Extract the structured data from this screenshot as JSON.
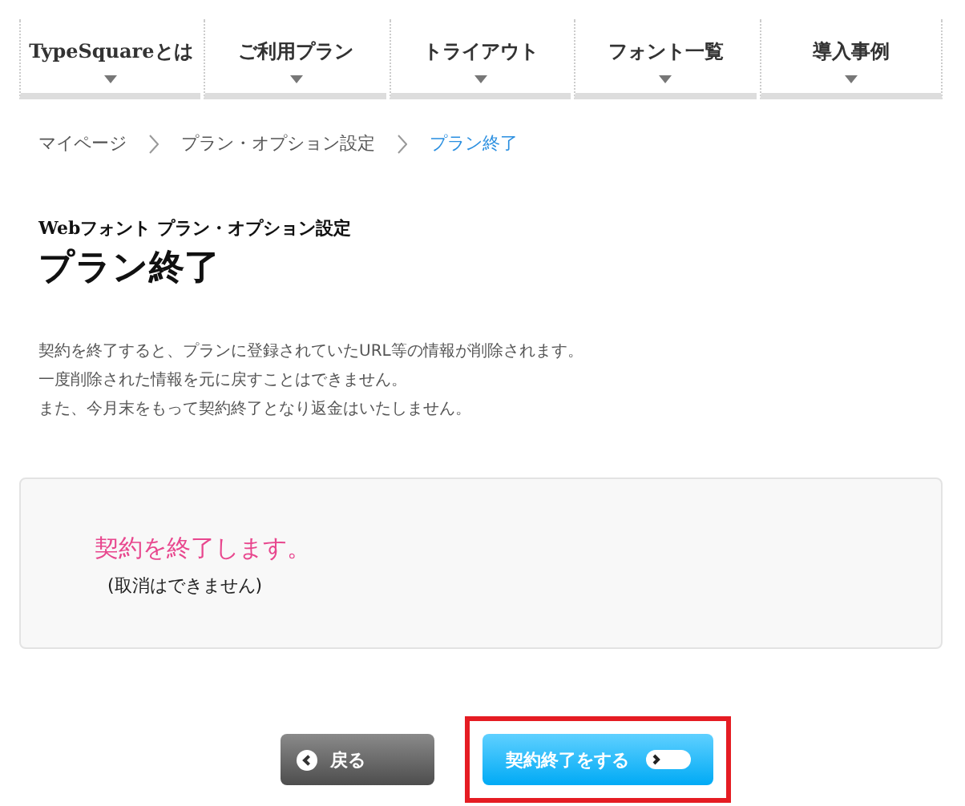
{
  "nav": [
    {
      "label": "TypeSquareとは"
    },
    {
      "label": "ご利用プラン"
    },
    {
      "label": "トライアウト"
    },
    {
      "label": "フォント一覧"
    },
    {
      "label": "導入事例"
    }
  ],
  "breadcrumb": [
    {
      "label": "マイページ",
      "selected": false
    },
    {
      "label": "プラン・オプション設定",
      "selected": false
    },
    {
      "label": "プラン終了",
      "selected": true
    }
  ],
  "subtitle": "Webフォント プラン・オプション設定",
  "title": "プラン終了",
  "notice": [
    "契約を終了すると、プランに登録されていたURL等の情報が削除されます。",
    "一度削除された情報を元に戻すことはできません。",
    "また、今月末をもって契約終了となり返金はいたしません。"
  ],
  "confirm_box": {
    "message": "契約を終了します。",
    "note": "(取消はできません)"
  },
  "buttons": [
    {
      "kind": "back",
      "label": "戻る",
      "highlighted": false
    },
    {
      "kind": "confirm",
      "label": "契約終了をする",
      "highlighted": true
    }
  ]
}
